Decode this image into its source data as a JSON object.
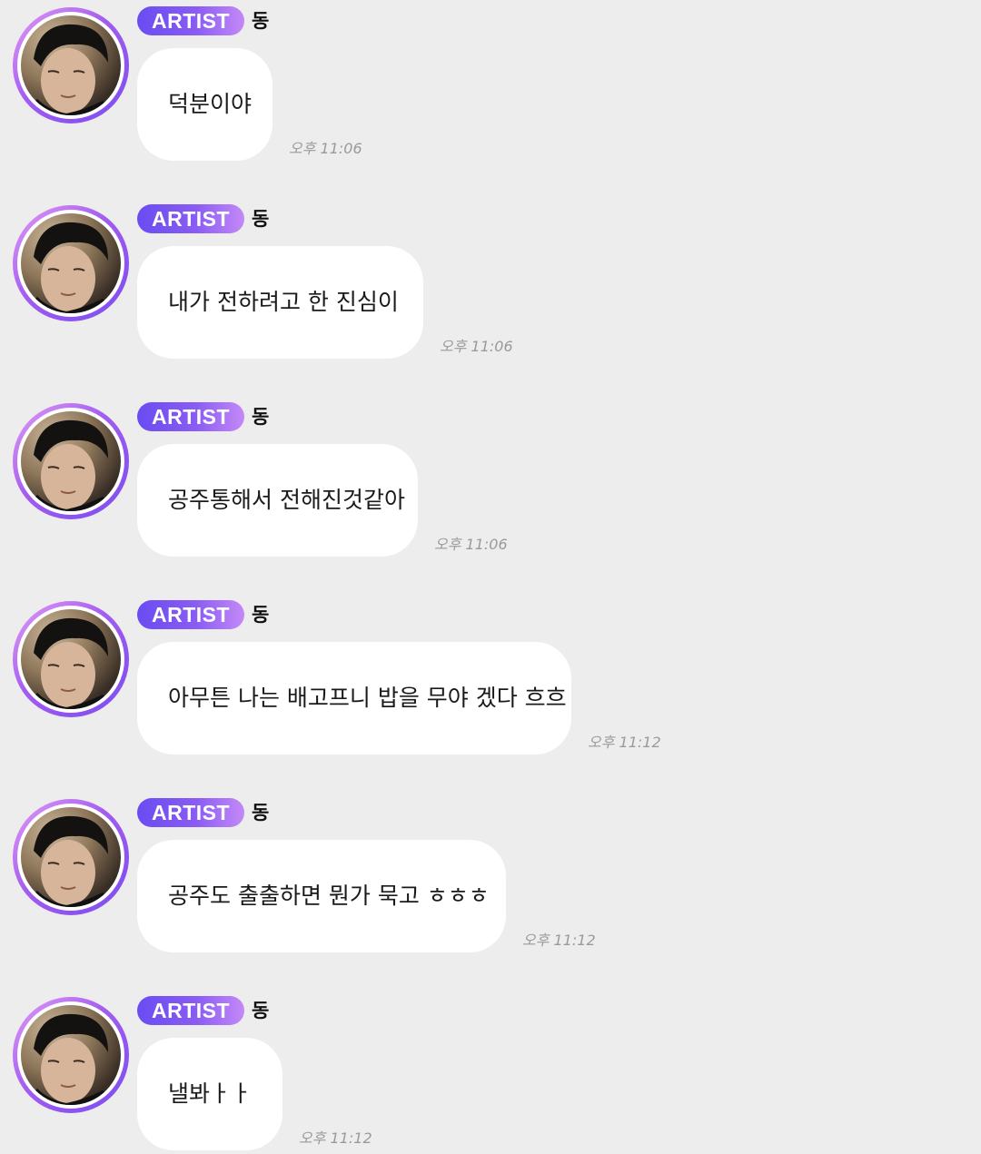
{
  "messages": [
    {
      "badge": "ARTIST",
      "sender": "동",
      "text": "덕분이야",
      "time": "오후 11:06"
    },
    {
      "badge": "ARTIST",
      "sender": "동",
      "text": "내가 전하려고 한 진심이",
      "time": "오후 11:06"
    },
    {
      "badge": "ARTIST",
      "sender": "동",
      "text": "공주통해서 전해진것같아",
      "time": "오후 11:06"
    },
    {
      "badge": "ARTIST",
      "sender": "동",
      "text": "아무튼 나는 배고프니 밥을 무야 겠다 흐흐",
      "time": "오후 11:12"
    },
    {
      "badge": "ARTIST",
      "sender": "동",
      "text": "공주도 출출하면 뭔가 묵고 ㅎㅎㅎ",
      "time": "오후 11:12"
    },
    {
      "badge": "ARTIST",
      "sender": "동",
      "text": "낼봐ㅏㅏ",
      "time": "오후 11:12"
    }
  ],
  "colors": {
    "background": "#ededed",
    "bubble": "#ffffff",
    "badge_start": "#6a4cf2",
    "badge_end": "#c489f8",
    "avatar_ring": "#a35cf0",
    "timestamp": "#9a9a9a"
  },
  "icons": {
    "avatar": "artist-profile-photo"
  }
}
